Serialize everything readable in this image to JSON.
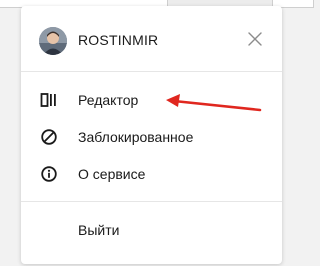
{
  "user": {
    "name": "ROSTINMIR"
  },
  "menu": {
    "items": [
      {
        "label": "Редактор",
        "icon": "columns-icon"
      },
      {
        "label": "Заблокированное",
        "icon": "blocked-icon"
      },
      {
        "label": "О сервисе",
        "icon": "info-icon"
      }
    ],
    "logout_label": "Выйти"
  },
  "colors": {
    "annotation_arrow": "#e0271f"
  }
}
